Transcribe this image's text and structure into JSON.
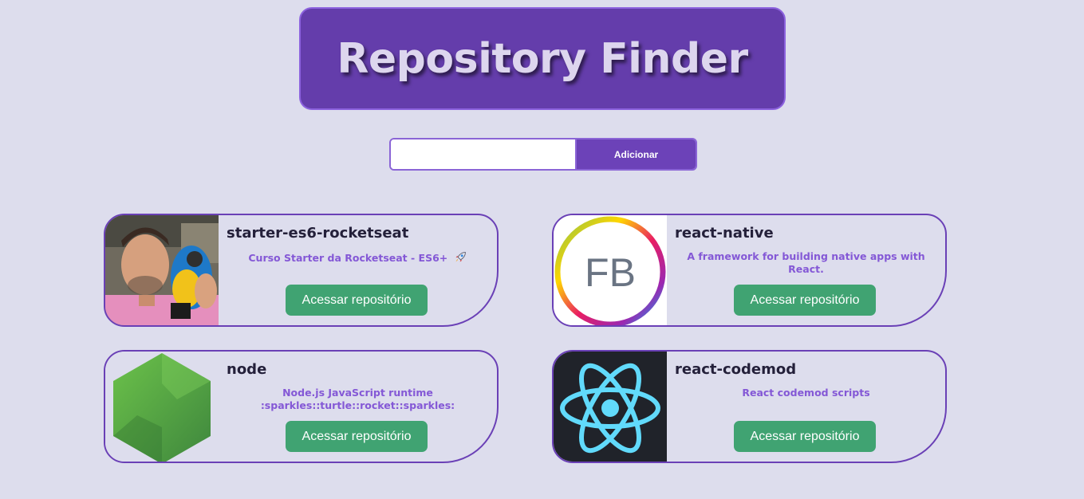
{
  "header": {
    "title": "Repository Finder"
  },
  "search": {
    "placeholder": "",
    "value": "",
    "button_label": "Adicionar"
  },
  "repositories": [
    {
      "name": "starter-es6-rocketseat",
      "description": "Curso Starter da Rocketseat - ES6+",
      "description_icon": "rocket-icon",
      "avatar": "user-photo-with-parrot",
      "button_label": "Acessar repositório"
    },
    {
      "name": "react-native",
      "description": "A framework for building native apps with React.",
      "avatar": "facebook-logo-ring",
      "avatar_text": "FB",
      "button_label": "Acessar repositório"
    },
    {
      "name": "node",
      "description_line1": "Node.js JavaScript runtime",
      "description_line2": ":sparkles::turtle::rocket::sparkles:",
      "avatar": "nodejs-hexagon-logo",
      "button_label": "Acessar repositório"
    },
    {
      "name": "react-codemod",
      "description": "React codemod scripts",
      "avatar": "react-atom-logo",
      "button_label": "Acessar repositório"
    }
  ],
  "colors": {
    "background": "#dddded",
    "primary": "#643dab",
    "accent": "#8458d6",
    "button": "#40a372"
  }
}
